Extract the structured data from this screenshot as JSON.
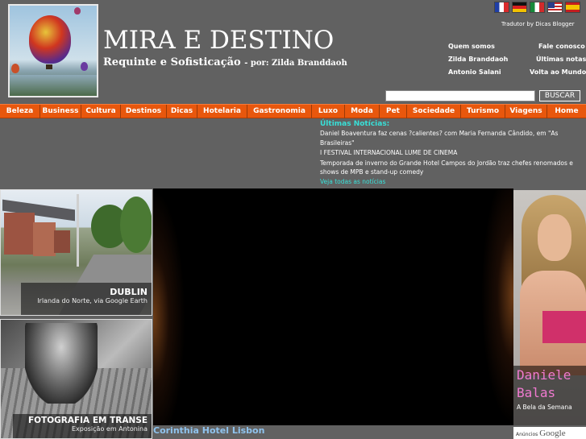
{
  "header": {
    "title": "MIRA E DESTINO",
    "subtitle": "Requinte e Sofisticação",
    "byline": "- por: Zilda Branddaoh",
    "translator": "Tradutor by Dicas Blogger"
  },
  "flags": [
    "fr",
    "de",
    "it",
    "us",
    "es"
  ],
  "top_links": {
    "quem_somos": "Quem somos",
    "fale_conosco": "Fale conosco",
    "zilda": "Zilda Branddaoh",
    "ultimas_notas": "Últimas notas",
    "antonio": "Antonio Salani",
    "volta_mundo": "Volta ao Mundo"
  },
  "search": {
    "button": "BUSCAR",
    "value": ""
  },
  "nav": [
    "Beleza",
    "Business",
    "Cultura",
    "Destinos",
    "Dicas",
    "Hotelaria",
    "Gastronomia",
    "Luxo",
    "Moda",
    "Pet",
    "Sociedade",
    "Turismo",
    "Viagens",
    "Home"
  ],
  "news": {
    "title": "Últimas Notícias:",
    "items": [
      "Daniel Boaventura faz cenas ?calientes? com Maria Fernanda Cândido, em \"As",
      "Brasileiras\"",
      "I FESTIVAL INTERNACIONAL LUME DE CINEMA",
      "Temporada de inverno do Grande Hotel Campos do Jordão traz chefes renomados e",
      "shows de MPB e stand-up comedy"
    ],
    "see_all": "Veja todas as notícias"
  },
  "features": {
    "dublin": {
      "title": "DUBLIN",
      "subtitle": "Irlanda do Norte, via Google Earth"
    },
    "fotografia": {
      "title": "FOTOGRAFIA EM TRANSE",
      "subtitle": "Exposição em Antonina"
    }
  },
  "video": {
    "caption": "Corinthia Hotel Lisbon"
  },
  "bela": {
    "name_line1": "Daniele",
    "name_line2": "Balas",
    "subtitle": "A Bela da Semana"
  },
  "ads": {
    "label": "Anúncios",
    "brand": "Google"
  },
  "colors": {
    "background": "#616161",
    "nav": "#e8570d",
    "accent": "#38e0d8",
    "bela_name": "#f07ad0"
  }
}
